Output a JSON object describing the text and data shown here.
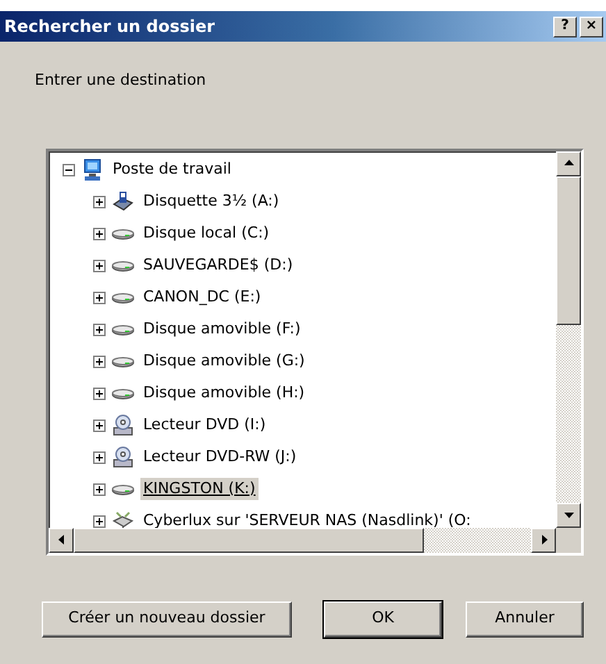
{
  "window": {
    "title": "Rechercher un dossier",
    "title_buttons": [
      "?",
      "×"
    ]
  },
  "prompt": "Entrer une destination",
  "tree": [
    {
      "label": "Poste de travail",
      "kind": "computer",
      "expanded": true,
      "selected": false,
      "children": [
        {
          "label": "Disquette 3½ (A:)",
          "kind": "floppy",
          "expanded": false,
          "selected": false
        },
        {
          "label": "Disque local (C:)",
          "kind": "disk",
          "expanded": false,
          "selected": false
        },
        {
          "label": "SAUVEGARDE$ (D:)",
          "kind": "disk",
          "expanded": false,
          "selected": false
        },
        {
          "label": "CANON_DC (E:)",
          "kind": "disk",
          "expanded": false,
          "selected": false
        },
        {
          "label": "Disque amovible (F:)",
          "kind": "disk",
          "expanded": false,
          "selected": false
        },
        {
          "label": "Disque amovible (G:)",
          "kind": "disk",
          "expanded": false,
          "selected": false
        },
        {
          "label": "Disque amovible (H:)",
          "kind": "disk",
          "expanded": false,
          "selected": false
        },
        {
          "label": "Lecteur DVD (I:)",
          "kind": "cdrom",
          "expanded": false,
          "selected": false
        },
        {
          "label": "Lecteur DVD-RW (J:)",
          "kind": "cdrom",
          "expanded": false,
          "selected": false
        },
        {
          "label": "KINGSTON (K:)",
          "kind": "disk",
          "expanded": false,
          "selected": true
        },
        {
          "label": "Cyberlux sur 'SERVEUR NAS (Nasdlink)' (O:",
          "kind": "network",
          "expanded": false,
          "selected": false
        }
      ]
    }
  ],
  "buttons": [
    {
      "label": "Créer un nouveau dossier",
      "default": false
    },
    {
      "label": "OK",
      "default": true
    },
    {
      "label": "Annuler",
      "default": false
    }
  ]
}
